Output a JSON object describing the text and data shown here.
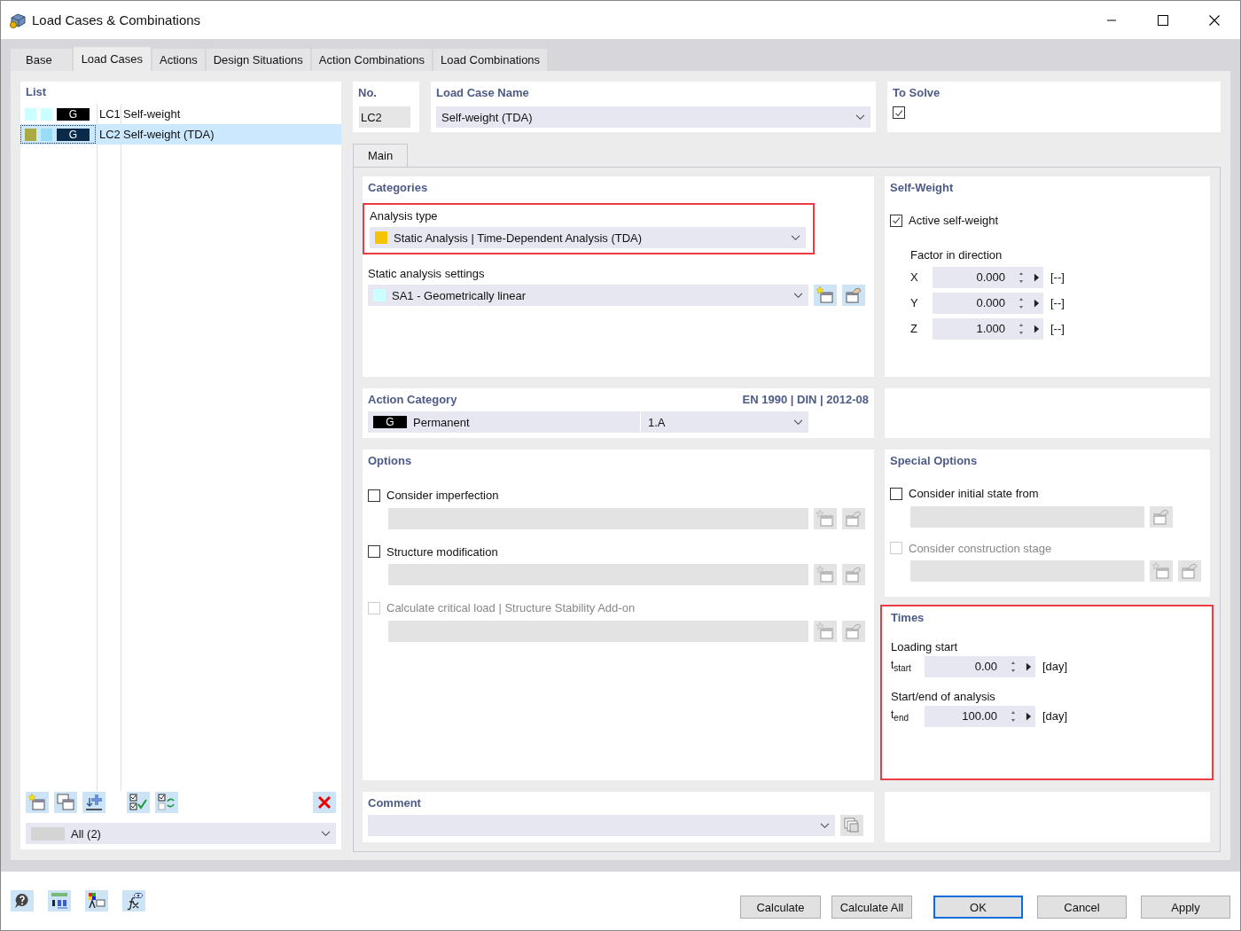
{
  "window": {
    "title": "Load Cases & Combinations"
  },
  "tabs": [
    {
      "label": "Base",
      "selected": false
    },
    {
      "label": "Load Cases",
      "selected": true
    },
    {
      "label": "Actions",
      "selected": false
    },
    {
      "label": "Design Situations",
      "selected": false
    },
    {
      "label": "Action Combinations",
      "selected": false
    },
    {
      "label": "Load Combinations",
      "selected": false
    }
  ],
  "list": {
    "title": "List",
    "items": [
      {
        "swatches": [
          {
            "color": "#ccffff"
          },
          {
            "color": "#ccffff"
          }
        ],
        "badge": "G",
        "no": "LC1",
        "name": "Self-weight",
        "selected": false
      },
      {
        "swatches": [
          {
            "color": "#aaaa44"
          },
          {
            "color": "#99ddf5"
          }
        ],
        "badge": "G",
        "no": "LC2",
        "name": "Self-weight (TDA)",
        "selected": true
      }
    ],
    "filter": "All (2)"
  },
  "number": {
    "label": "No.",
    "value": "LC2"
  },
  "name": {
    "label": "Load Case Name",
    "value": "Self-weight (TDA)"
  },
  "to_solve": {
    "label": "To Solve",
    "checked": true
  },
  "inner_tabs": [
    {
      "label": "Main",
      "selected": true
    }
  ],
  "categories": {
    "title": "Categories",
    "analysis_type": {
      "label": "Analysis type",
      "value": "Static Analysis | Time-Dependent Analysis (TDA)",
      "color": "#f5c400",
      "highlighted": true
    },
    "static_settings": {
      "label": "Static analysis settings",
      "value": "SA1 - Geometrically linear",
      "color": "#ccffff"
    }
  },
  "self_weight": {
    "title": "Self-Weight",
    "active": {
      "label": "Active self-weight",
      "checked": true
    },
    "factor_label": "Factor in direction",
    "factors": [
      {
        "axis": "X",
        "value": "0.000",
        "unit": "[--]"
      },
      {
        "axis": "Y",
        "value": "0.000",
        "unit": "[--]"
      },
      {
        "axis": "Z",
        "value": "1.000",
        "unit": "[--]"
      }
    ]
  },
  "action_category": {
    "title": "Action Category",
    "standard": "EN 1990 | DIN | 2012-08",
    "badge": "G",
    "value": "Permanent",
    "code": "1.A"
  },
  "options": {
    "title": "Options",
    "items": [
      {
        "label": "Consider imperfection",
        "checked": false,
        "disabled": false
      },
      {
        "label": "Structure modification",
        "checked": false,
        "disabled": false
      },
      {
        "label": "Calculate critical load | Structure Stability Add-on",
        "checked": false,
        "disabled": true
      }
    ]
  },
  "special_options": {
    "title": "Special Options",
    "items": [
      {
        "label": "Consider initial state from",
        "checked": false,
        "disabled": false,
        "kind": "edit"
      },
      {
        "label": "Consider construction stage",
        "checked": false,
        "disabled": true,
        "kind": "new-edit"
      }
    ]
  },
  "times": {
    "title": "Times",
    "highlighted": true,
    "fields": [
      {
        "label": "Loading start",
        "symbol": "t$_{start}$",
        "value": "0.00",
        "unit": "[day]"
      },
      {
        "label": "Start/end of analysis",
        "symbol": "t$_{end}$",
        "value": "100.00",
        "unit": "[day]"
      }
    ]
  },
  "comment": {
    "title": "Comment"
  },
  "buttons": [
    {
      "label": "Calculate",
      "default": false
    },
    {
      "label": "Calculate All",
      "default": false
    },
    {
      "label": "OK",
      "default": true
    },
    {
      "label": "Cancel",
      "default": false
    },
    {
      "label": "Apply",
      "default": false
    }
  ]
}
